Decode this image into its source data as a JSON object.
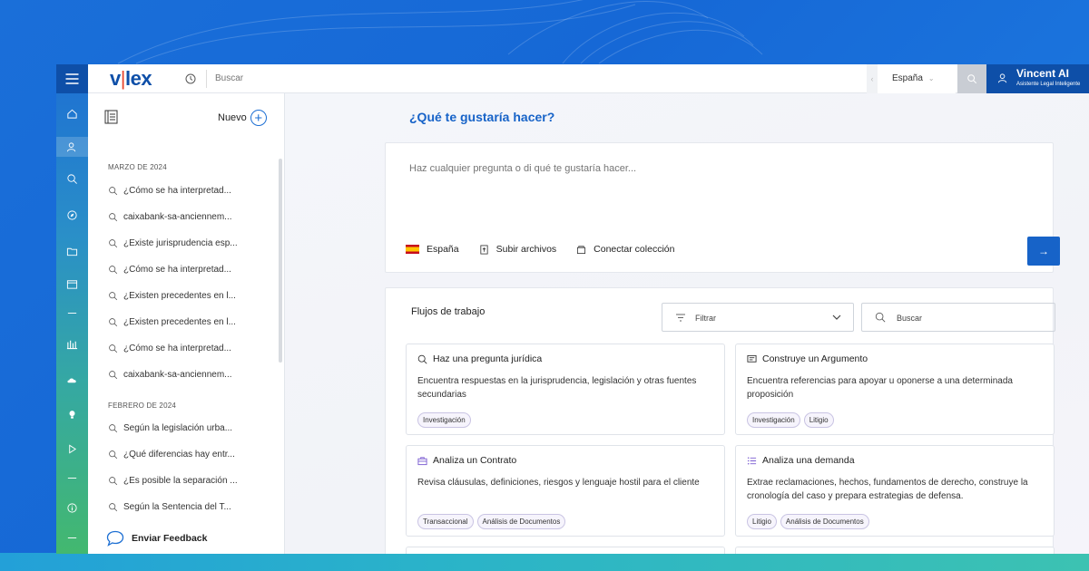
{
  "topbar": {
    "logo_left": "v",
    "logo_bar": "|",
    "logo_right": "lex",
    "search_placeholder": "Buscar",
    "country": "España",
    "user_name": "Vincent AI",
    "user_role": "Asistente Legal Inteligente"
  },
  "sidebar": {
    "new_label": "Nuevo",
    "sections": [
      {
        "heading": "MARZO DE 2024",
        "items": [
          "¿Cómo se ha interpretad...",
          "caixabank-sa-anciennem...",
          "¿Existe jurisprudencia esp...",
          "¿Cómo se ha interpretad...",
          "¿Existen precedentes en l...",
          "¿Existen precedentes en l...",
          "¿Cómo se ha interpretad...",
          "caixabank-sa-anciennem..."
        ]
      },
      {
        "heading": "FEBRERO DE 2024",
        "items": [
          "Según la legislación urba...",
          "¿Qué diferencias hay entr...",
          "¿Es posible la separación ...",
          "Según la Sentencia del T..."
        ]
      }
    ],
    "feedback": "Enviar Feedback"
  },
  "main": {
    "title": "¿Qué te gustaría hacer?",
    "ask_placeholder": "Haz cualquier pregunta o di qué te gustaría hacer...",
    "tools": {
      "country": "España",
      "upload": "Subir archivos",
      "connect": "Conectar colección"
    },
    "send": "→",
    "flows": {
      "title": "Flujos de trabajo",
      "filter": "Filtrar",
      "search": "Buscar",
      "cards": [
        {
          "icon": "search-icon",
          "title": "Haz una pregunta jurídica",
          "desc": "Encuentra respuestas en la jurisprudencia, legislación y otras fuentes secundarias",
          "tags": [
            "Investigación"
          ]
        },
        {
          "icon": "comment-icon",
          "title": "Construye un Argumento",
          "desc": "Encuentra referencias para apoyar u oponerse a una determinada proposición",
          "tags": [
            "Investigación",
            "Litigio"
          ]
        },
        {
          "icon": "briefcase-icon",
          "title": "Analiza un Contrato",
          "desc": "Revisa cláusulas, definiciones, riesgos y lenguaje hostil para el cliente",
          "tags": [
            "Transaccional",
            "Análisis de Documentos"
          ]
        },
        {
          "icon": "list-icon",
          "title": "Analiza una demanda",
          "desc": "Extrae reclamaciones, hechos, fundamentos de derecho, construye la cronología del caso y prepara estrategias de defensa.",
          "tags": [
            "Litigio",
            "Análisis de Documentos"
          ]
        }
      ]
    }
  },
  "colors": {
    "brand": "#0e4fa8",
    "accent": "#1763c8",
    "logo_bar": "#e8452c"
  }
}
